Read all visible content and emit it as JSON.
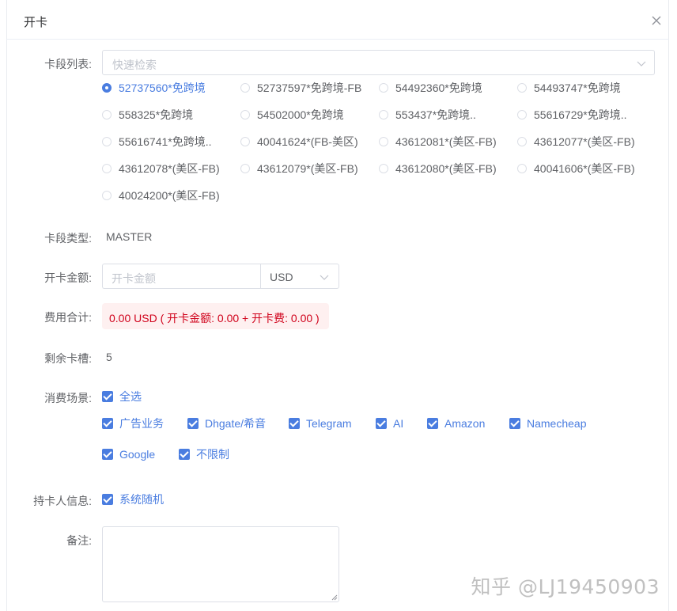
{
  "dialog": {
    "title": "开卡"
  },
  "form": {
    "segment": {
      "label": "卡段列表:",
      "placeholder": "快速检索",
      "options": [
        "52737560*免跨境",
        "52737597*免跨境-FB",
        "54492360*免跨境",
        "54493747*免跨境",
        "558325*免跨境",
        "54502000*免跨境",
        "553437*免跨境..",
        "55616729*免跨境..",
        "55616741*免跨境..",
        "40041624*(FB-美区)",
        "43612081*(美区-FB)",
        "43612077*(美区-FB)",
        "43612078*(美区-FB)",
        "43612079*(美区-FB)",
        "43612080*(美区-FB)",
        "40041606*(美区-FB)",
        "40024200*(美区-FB)"
      ],
      "selected": "52737560*免跨境"
    },
    "card_type": {
      "label": "卡段类型:",
      "value": "MASTER"
    },
    "amount": {
      "label": "开卡金额:",
      "placeholder": "开卡金额",
      "currency": "USD"
    },
    "fee_total": {
      "label": "费用合计:",
      "text": "0.00 USD ( 开卡金额: 0.00 + 开卡费: 0.00 )"
    },
    "slots": {
      "label": "剩余卡槽:",
      "value": "5"
    },
    "scenarios": {
      "label": "消费场景:",
      "select_all": "全选",
      "items": [
        "广告业务",
        "Dhgate/希音",
        "Telegram",
        "AI",
        "Amazon",
        "Namecheap",
        "Google",
        "不限制"
      ]
    },
    "holder": {
      "label": "持卡人信息:",
      "option": "系统随机"
    },
    "remarks": {
      "label": "备注:"
    }
  },
  "watermark": "知乎 @LJ19450903",
  "colors": {
    "primary": "#4a7de0",
    "fee_text": "#d0021b",
    "fee_bg": "#fef0f0"
  }
}
